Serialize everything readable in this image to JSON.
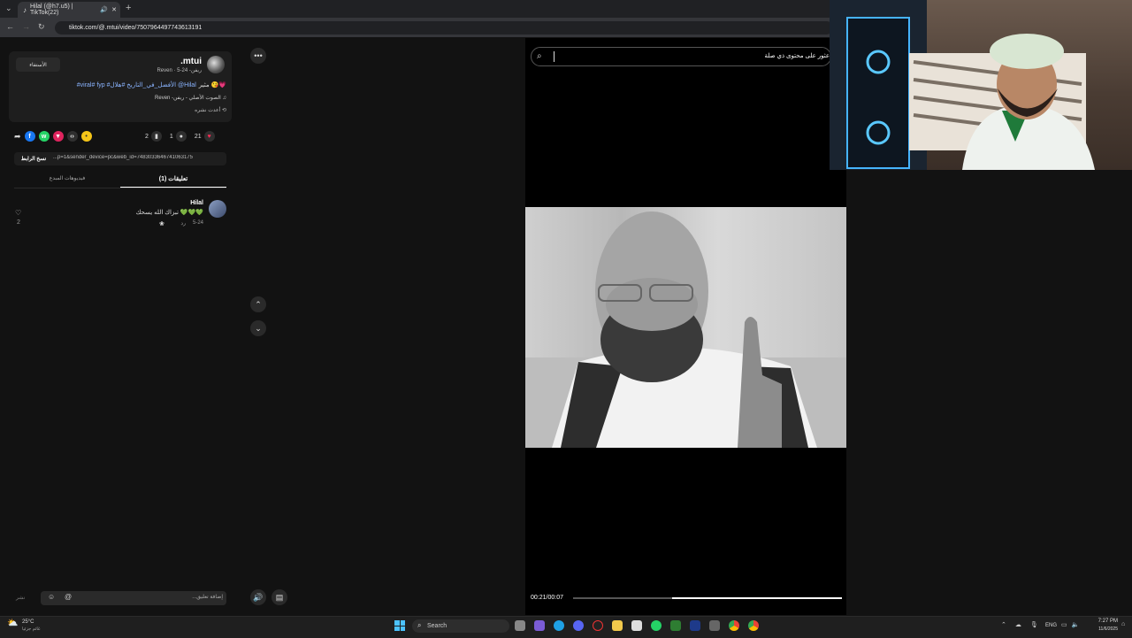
{
  "browser": {
    "tab_title": "Hilal (@h7.u5) | TikTok(22)",
    "url": "tiktok.com/@.mtui/video/7507964497743613191"
  },
  "post": {
    "username": ".mtui",
    "sub": "ريفن- Reven · 5-24",
    "follow": "الأستفاء",
    "caption_prefix": "مثير 😘💗",
    "caption": "#viral# fyp #الأفضل_في_التاريخ #هلال @Hilal",
    "sound": "الصوت الأصلي - ريفن- Reven",
    "reposted": "أعدت نشره",
    "likes": "21",
    "comments": "1",
    "saves": "2",
    "link": "...p=1&sender_device=pc&web_id=7483033646741063175",
    "copy_link": "نسخ الرابط"
  },
  "tabs": {
    "comments": "(1) تعليقات",
    "creator_videos": "فيديوهات المبدع"
  },
  "comment": {
    "author": "Hilal",
    "text": "💚💚💚 تبزاك الله يسحك",
    "date": "5-24",
    "reply": "رد",
    "likes": "2"
  },
  "composer": {
    "placeholder": "إضافة تعليق...",
    "post": "نشر"
  },
  "search": {
    "placeholder": "عثور على محتوى ذي صلة"
  },
  "player": {
    "time": "00:21/00:07",
    "progress": 0.37
  },
  "taskbar": {
    "weather_temp": "25°C",
    "weather_text": "غائم جزئيا",
    "search": "Search",
    "lang": "ENG",
    "time": "7:27 PM",
    "date": "11/6/2025"
  },
  "icons": [
    "back-icon",
    "forward-icon",
    "reload-icon",
    "search-icon",
    "heart-icon",
    "comment-icon",
    "bookmark-icon",
    "share-icon",
    "more-icon",
    "chevron-up-icon",
    "chevron-down-icon",
    "volume-icon",
    "emoji-icon",
    "mention-icon",
    "windows-icon"
  ]
}
